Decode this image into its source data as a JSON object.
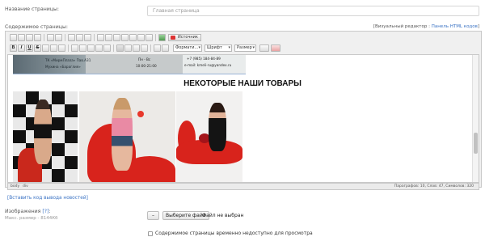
{
  "page_name": {
    "label": "Название страницы:",
    "placeholder": "Главная страница"
  },
  "content": {
    "label": "Содержимое страницы:",
    "editor_mode_prefix": "[Визуальный редактор : ",
    "editor_mode_link": "Панель HTML кодов",
    "editor_mode_suffix": "]"
  },
  "toolbar": {
    "source_label": "Источник",
    "format_label": "Формати...",
    "font_label": "Шрифт",
    "size_label": "Размер",
    "bold": "B",
    "italic": "I",
    "underline": "U",
    "strike": "S"
  },
  "editor_content": {
    "banner_text_1": "ТК «МирмПлаза» Пав.А31",
    "banner_text_2": "Мухина «Бараглия»",
    "banner_hours": "Пн - Вс",
    "banner_hours_2": "10:00-21:00",
    "banner_phone": "+7 (985) 184-84-89",
    "banner_email": "e-mail: kmeli-ru@yandex.ru",
    "heading": "НЕКОТОРЫЕ НАШИ ТОВАРЫ"
  },
  "statusbar": {
    "path_1": "body",
    "path_2": "div",
    "stats": "Параграфов: 10, Слов: 47, Символов: 320"
  },
  "news_link": "[Вставить код вывода новостей]",
  "images": {
    "label_prefix": "Изображения ",
    "label_link": "[?]",
    "label_suffix": ":",
    "max_size": "Макс. размер - 8144Кб",
    "remove_label": "–",
    "choose_button": "Выберите файл",
    "no_file": "Файл не выбран"
  },
  "unavailable_label": "Содержимое страницы временно недоступно для просмотра",
  "colors": {
    "red_chair": "#d8231c",
    "link": "#3b73c4",
    "toolbar_bg": "#f0f0f0"
  }
}
